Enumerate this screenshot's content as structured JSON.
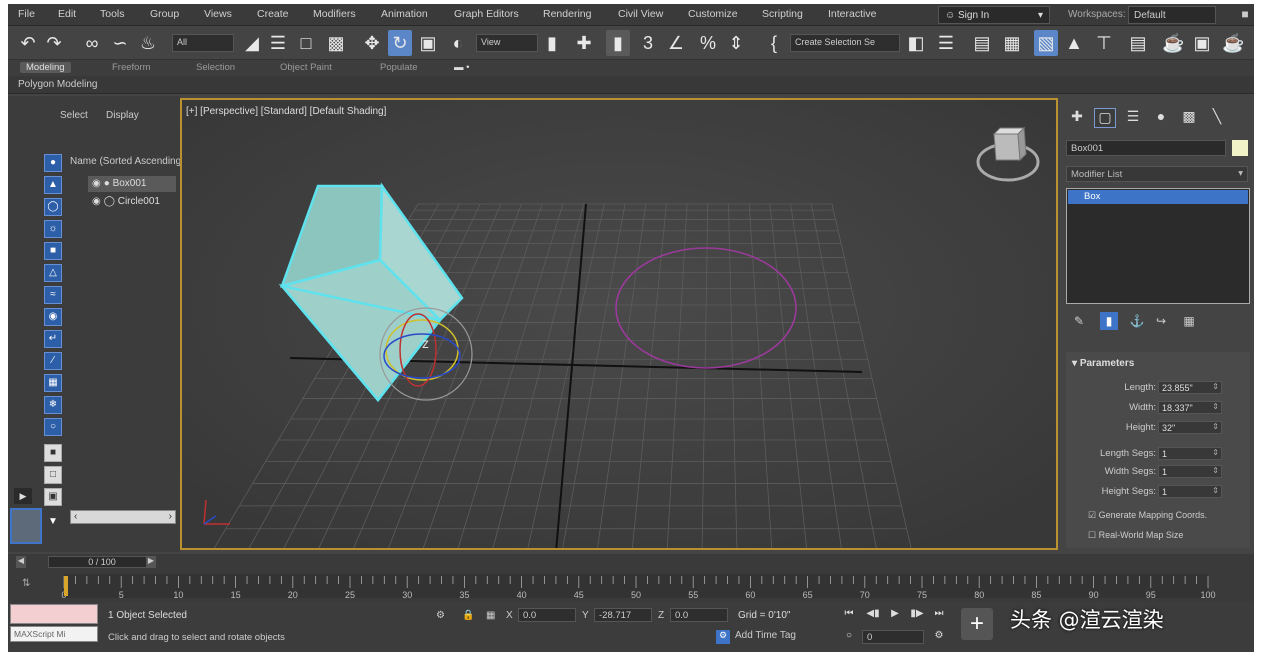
{
  "menubar": {
    "items": [
      "File",
      "Edit",
      "Tools",
      "Group",
      "Views",
      "Create",
      "Modifiers",
      "Animation",
      "Graph Editors",
      "Rendering",
      "Civil View",
      "Customize",
      "Scripting",
      "Interactive"
    ],
    "sign_in": "Sign In",
    "workspaces_label": "Workspaces:",
    "workspace": "Default"
  },
  "toolbar": {
    "selection_filter": "All",
    "reference_coord": "View",
    "named_selection": "Create Selection Se"
  },
  "ribbon": {
    "tabs": [
      "Modeling",
      "Freeform",
      "Selection",
      "Object Paint",
      "Populate"
    ],
    "active_tab": "Modeling",
    "subtitle": "Polygon Modeling"
  },
  "scene_explorer": {
    "tabs": [
      "Select",
      "Display"
    ],
    "header": "Name (Sorted Ascending)",
    "objects": [
      "Box001",
      "Circle001"
    ],
    "selected": "Box001"
  },
  "viewport": {
    "label": "[+] [Perspective] [Standard] [Default Shading]"
  },
  "command_panel": {
    "object_name": "Box001",
    "modifier_list": "Modifier List",
    "stack_item": "Box",
    "parameters": {
      "title": "Parameters",
      "fields": [
        {
          "label": "Length:",
          "value": "23.855\""
        },
        {
          "label": "Width:",
          "value": "18.337\""
        },
        {
          "label": "Height:",
          "value": "32\""
        },
        {
          "label": "Length Segs:",
          "value": "1"
        },
        {
          "label": "Width Segs:",
          "value": "1"
        },
        {
          "label": "Height Segs:",
          "value": "1"
        }
      ],
      "checks": [
        "Generate Mapping Coords.",
        "Real-World Map Size"
      ]
    }
  },
  "timeline": {
    "frame_display": "0 / 100",
    "ticks": [
      "0",
      "5",
      "10",
      "15",
      "20",
      "25",
      "30",
      "35",
      "40",
      "45",
      "50",
      "55",
      "60",
      "65",
      "70",
      "75",
      "80",
      "85",
      "90",
      "95",
      "100"
    ]
  },
  "status": {
    "script_text": "MAXScript Mi",
    "selected": "1 Object Selected",
    "prompt": "Click and drag to select and rotate objects",
    "x": "0.0",
    "y": "-28.717",
    "z": "0.0",
    "grid": "Grid = 0'10\"",
    "add_time_tag": "Add Time Tag",
    "frame": "0"
  },
  "watermark": "头条 @渲云渲染"
}
